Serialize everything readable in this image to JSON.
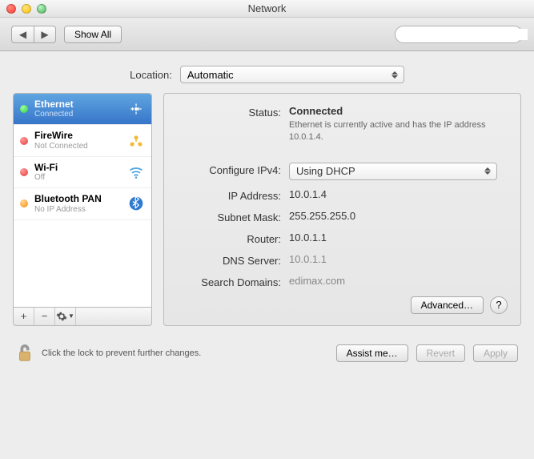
{
  "window": {
    "title": "Network"
  },
  "toolbar": {
    "showAll": "Show All",
    "searchPlaceholder": ""
  },
  "location": {
    "label": "Location:",
    "value": "Automatic"
  },
  "sidebar": {
    "items": [
      {
        "name": "Ethernet",
        "status": "Connected",
        "dot": "green"
      },
      {
        "name": "FireWire",
        "status": "Not Connected",
        "dot": "red"
      },
      {
        "name": "Wi-Fi",
        "status": "Off",
        "dot": "red"
      },
      {
        "name": "Bluetooth PAN",
        "status": "No IP Address",
        "dot": "orange"
      }
    ]
  },
  "details": {
    "statusLabel": "Status:",
    "statusValue": "Connected",
    "statusDesc": "Ethernet is currently active and has the IP address 10.0.1.4.",
    "configLabel": "Configure IPv4:",
    "configValue": "Using DHCP",
    "ipLabel": "IP Address:",
    "ipValue": "10.0.1.4",
    "subnetLabel": "Subnet Mask:",
    "subnetValue": "255.255.255.0",
    "routerLabel": "Router:",
    "routerValue": "10.0.1.1",
    "dnsLabel": "DNS Server:",
    "dnsValue": "10.0.1.1",
    "searchDomLabel": "Search Domains:",
    "searchDomValue": "edimax.com",
    "advanced": "Advanced…"
  },
  "bottom": {
    "lockText": "Click the lock to prevent further changes.",
    "assist": "Assist me…",
    "revert": "Revert",
    "apply": "Apply"
  }
}
